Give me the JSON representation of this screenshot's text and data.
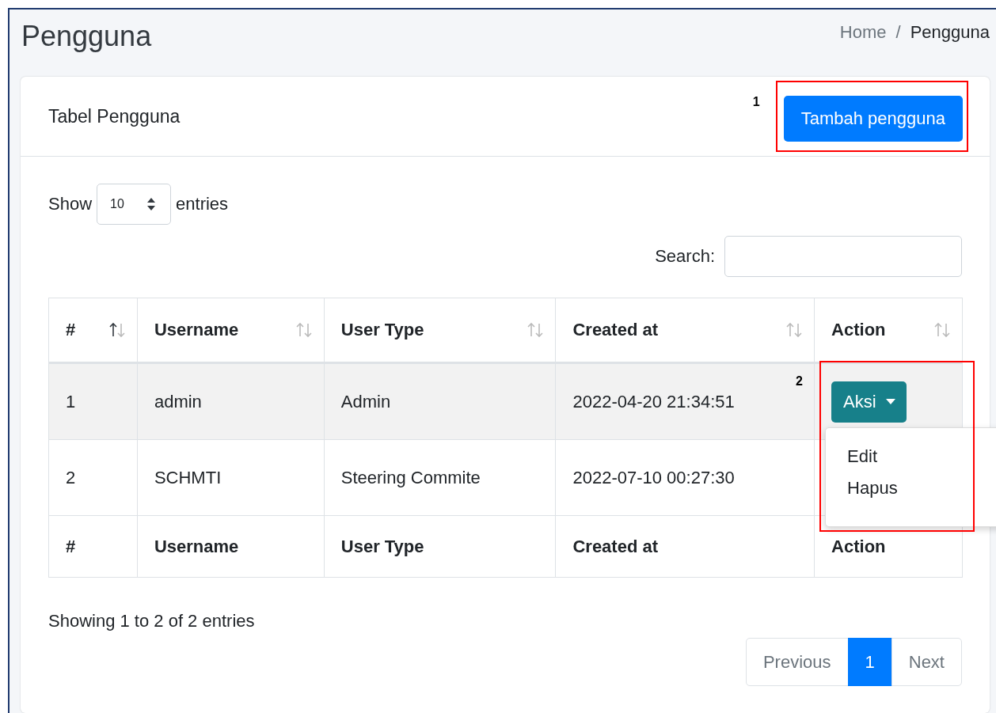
{
  "page": {
    "title": "Pengguna",
    "breadcrumb": [
      {
        "label": "Home",
        "current": false
      },
      {
        "label": "Pengguna",
        "current": true
      }
    ],
    "breadcrumb_separator": "/"
  },
  "card": {
    "title": "Tabel Pengguna",
    "add_button": "Tambah pengguna",
    "annotation": "1"
  },
  "length_menu": {
    "prefix": "Show",
    "value": "10",
    "suffix": "entries"
  },
  "search": {
    "label": "Search:"
  },
  "table": {
    "columns": [
      {
        "label": "#",
        "sorted": true
      },
      {
        "label": "Username",
        "sorted": false
      },
      {
        "label": "User Type",
        "sorted": false
      },
      {
        "label": "Created at",
        "sorted": false
      },
      {
        "label": "Action",
        "sorted": false
      }
    ],
    "rows": [
      {
        "cells": [
          "1",
          "admin",
          "Admin",
          "2022-04-20 21:34:51"
        ],
        "action": {
          "label": "Aksi",
          "annotation": "2",
          "menu": [
            "Edit",
            "Hapus"
          ]
        }
      },
      {
        "cells": [
          "2",
          "SCHMTI",
          "Steering Commite",
          "2022-07-10 00:27:30"
        ]
      }
    ],
    "footer": [
      "#",
      "Username",
      "User Type",
      "Created at",
      "Action"
    ]
  },
  "info": "Showing 1 to 2 of 2 entries",
  "pagination": [
    {
      "label": "Previous",
      "selected": false,
      "disabled": true
    },
    {
      "label": "1",
      "selected": true,
      "disabled": false
    },
    {
      "label": "Next",
      "selected": false,
      "disabled": true
    }
  ]
}
